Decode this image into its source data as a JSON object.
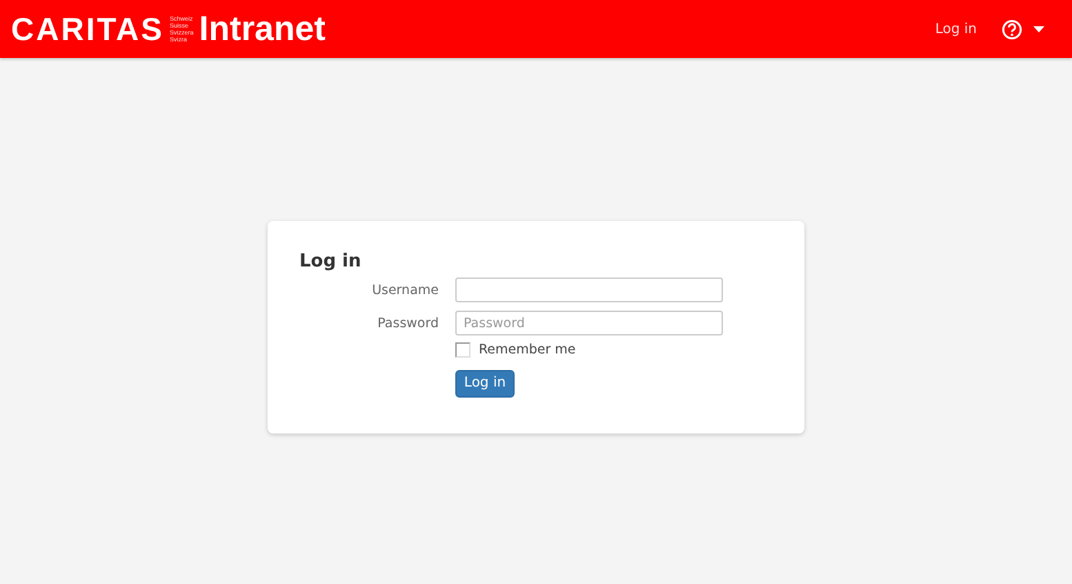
{
  "header": {
    "brand": "CARITAS",
    "brand_languages": [
      "Schweiz",
      "Suisse",
      "Svizzera",
      "Svizra"
    ],
    "app_name": "Intranet",
    "nav_login": "Log in",
    "help_menu": {
      "expanded": false
    }
  },
  "login": {
    "title": "Log in",
    "fields": [
      {
        "label": "Username"
      },
      {
        "label": "Password",
        "placeholder": "Password"
      }
    ],
    "remember_me": {
      "label": "Remember me",
      "checked": false
    },
    "submit": "Log in"
  }
}
